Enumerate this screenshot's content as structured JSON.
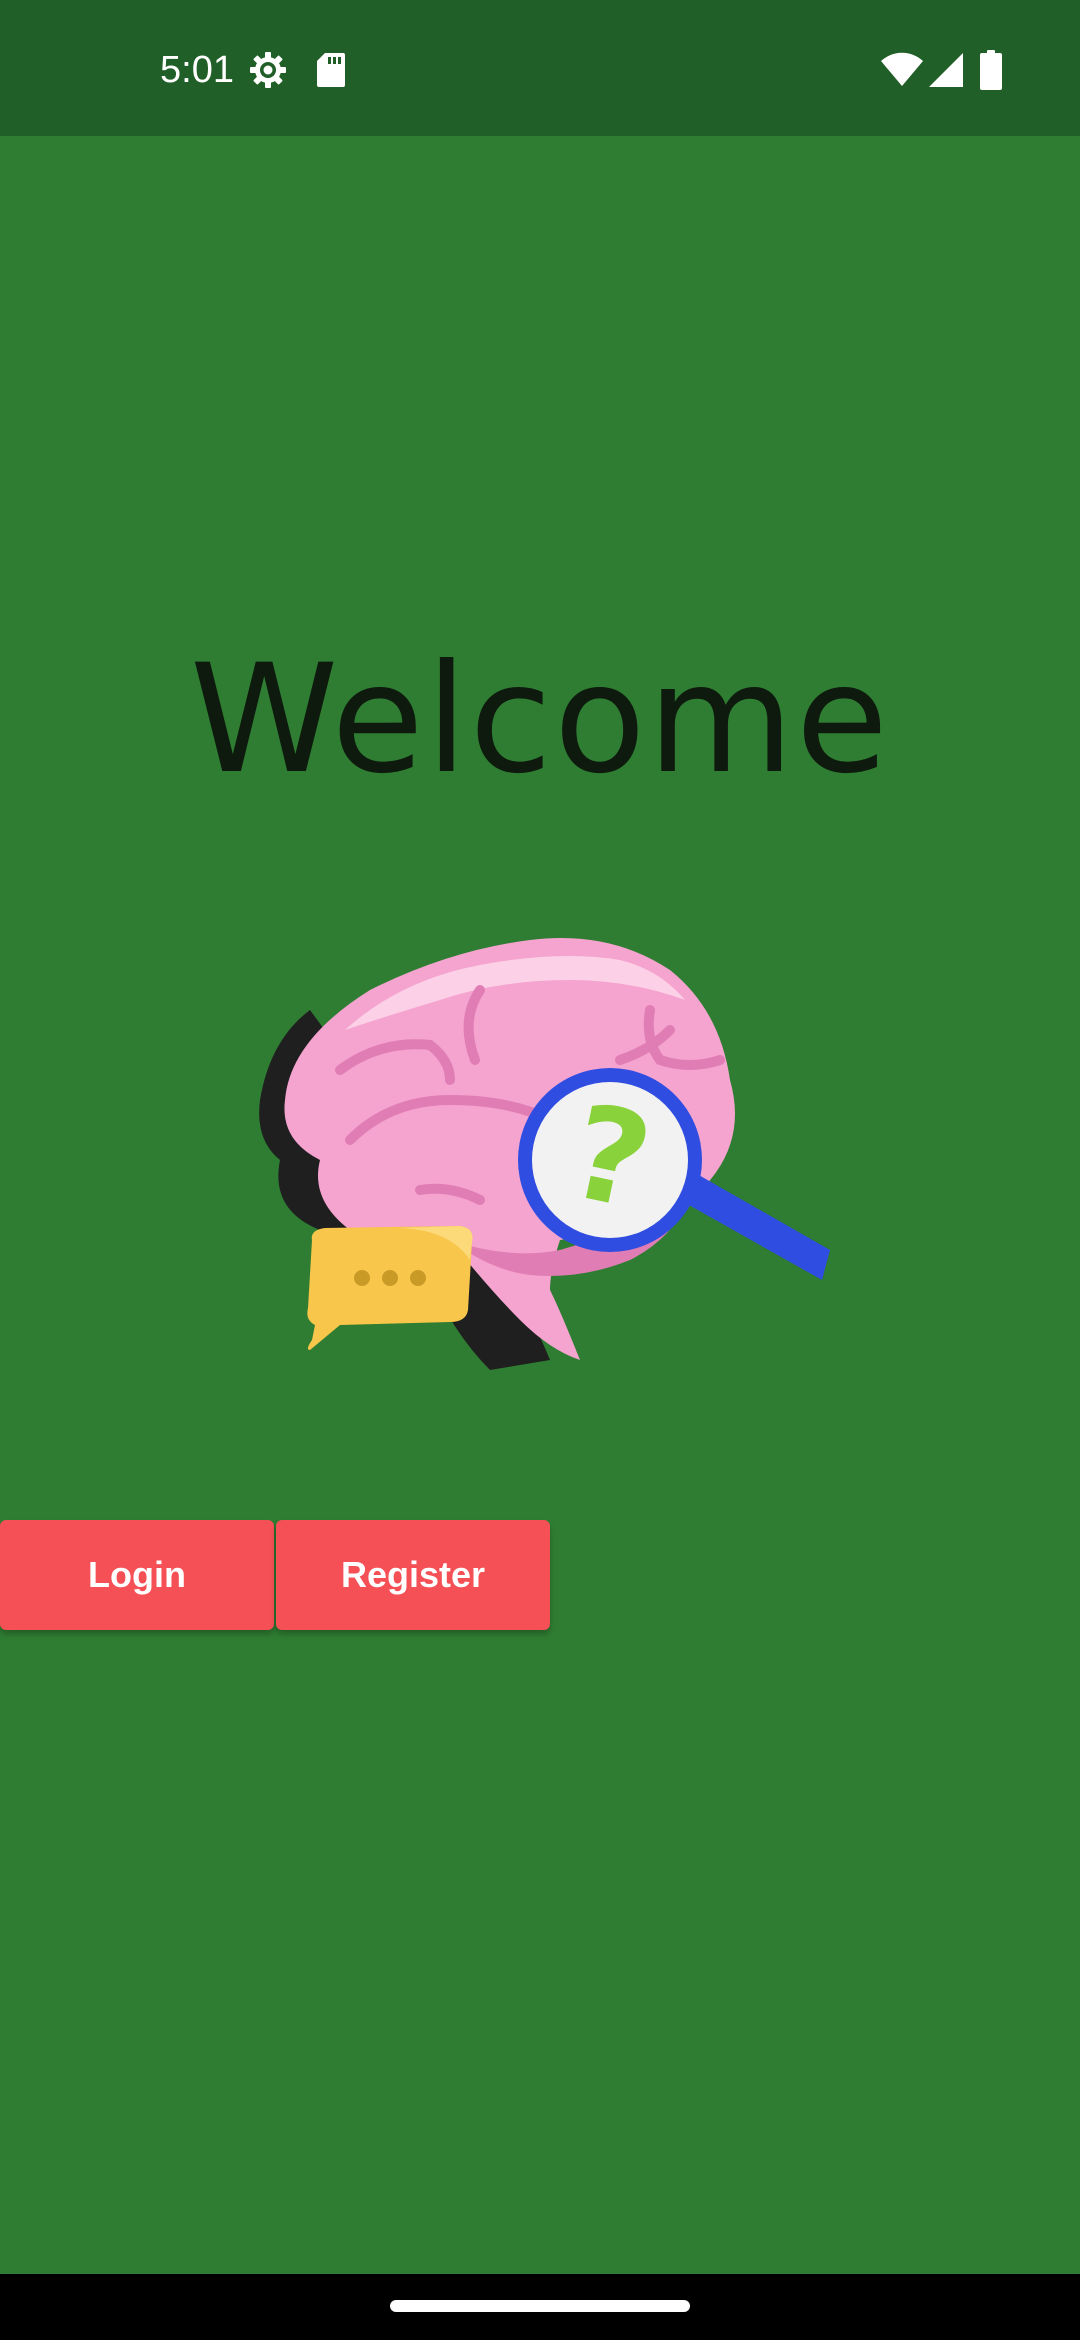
{
  "status_bar": {
    "time": "5:01",
    "icons_left": [
      "settings-gear-icon",
      "sd-card-icon"
    ],
    "icons_right": [
      "wifi-icon",
      "cellular-signal-icon",
      "battery-icon"
    ]
  },
  "main": {
    "title": "Welcome",
    "illustration": "brain-with-magnifier-and-chat-bubble",
    "buttons": {
      "login": "Login",
      "register": "Register"
    }
  },
  "colors": {
    "background": "#2f7d32",
    "status_bar": "#215f29",
    "button": "#f55056",
    "button_text": "#ffffff",
    "title_text": "#0d1a0d",
    "nav_bar": "#000000"
  }
}
